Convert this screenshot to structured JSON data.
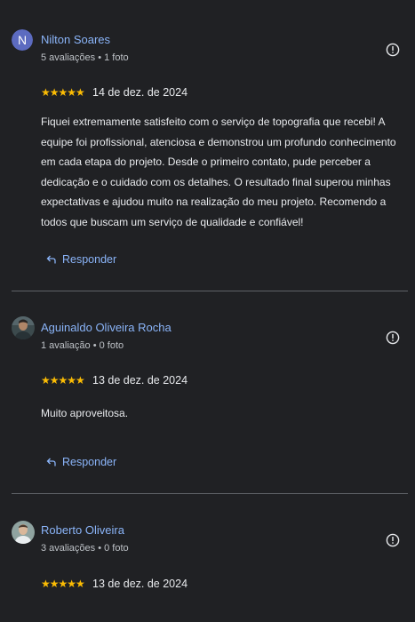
{
  "reviews": [
    {
      "avatar_letter": "N",
      "name": "Nilton Soares",
      "meta": "5 avaliações • 1 foto",
      "rating": "★★★★★",
      "date": "14 de dez. de 2024",
      "text": "Fiquei extremamente satisfeito com o serviço de topografia que recebi! A equipe foi profissional, atenciosa e demonstrou um profundo conhecimento em cada etapa do projeto. Desde o primeiro contato, pude perceber a dedicação e o cuidado com os detalhes. O resultado final superou minhas expectativas e ajudou muito na realização do meu projeto. Recomendo a todos que buscam um serviço de qualidade e confiável!",
      "reply_label": "Responder"
    },
    {
      "name": "Aguinaldo Oliveira Rocha",
      "meta": "1 avaliação • 0 foto",
      "rating": "★★★★★",
      "date": "13 de dez. de 2024",
      "text": "Muito aproveitosa.",
      "reply_label": "Responder"
    },
    {
      "name": "Roberto Oliveira",
      "meta": "3 avaliações • 0 foto",
      "rating": "★★★★★",
      "date": "13 de dez. de 2024"
    }
  ],
  "icons": {
    "more": "info-circle-icon",
    "reply": "reply-arrow-icon"
  },
  "colors": {
    "background": "#202124",
    "name": "#8ab4f8",
    "star": "#fbbc04",
    "divider": "#5f6368",
    "avatar_n": "#5c6bc0"
  }
}
